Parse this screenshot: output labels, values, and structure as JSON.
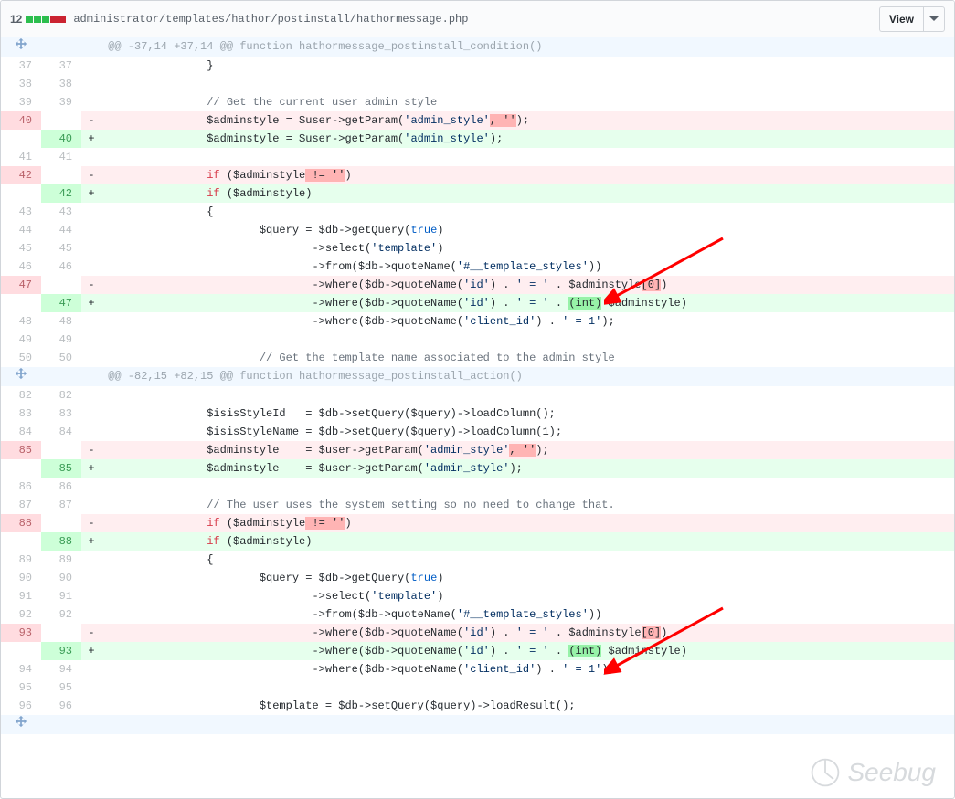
{
  "header": {
    "diff_count": "12",
    "file_path": "administrator/templates/hathor/postinstall/hathormessage.php",
    "view_btn": "View"
  },
  "hunk1": {
    "text": " @@ -37,14 +37,14 @@ function hathormessage_postinstall_condition()"
  },
  "hunk2": {
    "text": " @@ -82,15 +82,15 @@ function hathormessage_postinstall_action()"
  },
  "lines": {
    "l37": "\t\t}",
    "l38": "",
    "l39_c": "\t\t// Get the current user admin style",
    "l40d_a": "\t\t$adminstyle = $user->getParam(",
    "l40d_b": "'admin_style'",
    "l40d_c": ", ''",
    "l40d_d": ");",
    "l40a_a": "\t\t$adminstyle = $user->getParam(",
    "l40a_b": "'admin_style'",
    "l40a_c": ");",
    "l41": "",
    "l42d_a": "\t\t",
    "l42d_if": "if",
    "l42d_b": " ($adminstyle",
    "l42d_c": " != ''",
    "l42d_d": ")",
    "l42a_a": "\t\t",
    "l42a_if": "if",
    "l42a_b": " ($adminstyle)",
    "l43": "\t\t{",
    "l44_a": "\t\t\t$query = $db->getQuery(",
    "l44_true": "true",
    "l44_b": ")",
    "l45_a": "\t\t\t\t->select(",
    "l45_b": "'template'",
    "l45_c": ")",
    "l46_a": "\t\t\t\t->from($db->quoteName(",
    "l46_b": "'#__template_styles'",
    "l46_c": "))",
    "l47d_a": "\t\t\t\t->where($db->quoteName(",
    "l47d_b": "'id'",
    "l47d_c": ") . ",
    "l47d_d": "' = '",
    "l47d_e": " . $adminstyle",
    "l47d_f": "[0]",
    "l47d_g": ")",
    "l47a_a": "\t\t\t\t->where($db->quoteName(",
    "l47a_b": "'id'",
    "l47a_c": ") . ",
    "l47a_d": "' = '",
    "l47a_e": " . ",
    "l47a_f": "(int)",
    "l47a_g": " $adminstyle)",
    "l48_a": "\t\t\t\t->where($db->quoteName(",
    "l48_b": "'client_id'",
    "l48_c": ") . ",
    "l48_d": "' = 1'",
    "l48_e": ");",
    "l49": "",
    "l50_c": "\t\t\t// Get the template name associated to the admin style",
    "l82": "",
    "l83_a": "\t\t$isisStyleId   = $db->setQuery($query)->loadColumn();",
    "l84_a": "\t\t$isisStyleName = $db->setQuery($query)->loadColumn(1);",
    "l85d_a": "\t\t$adminstyle    = $user->getParam(",
    "l85d_b": "'admin_style'",
    "l85d_c": ", ''",
    "l85d_d": ");",
    "l85a_a": "\t\t$adminstyle    = $user->getParam(",
    "l85a_b": "'admin_style'",
    "l85a_c": ");",
    "l86": "",
    "l87_c": "\t\t// The user uses the system setting so no need to change that.",
    "l88d_a": "\t\t",
    "l88d_if": "if",
    "l88d_b": " ($adminstyle",
    "l88d_c": " != ''",
    "l88d_d": ")",
    "l88a_a": "\t\t",
    "l88a_if": "if",
    "l88a_b": " ($adminstyle)",
    "l89": "\t\t{",
    "l90_a": "\t\t\t$query = $db->getQuery(",
    "l90_true": "true",
    "l90_b": ")",
    "l91_a": "\t\t\t\t->select(",
    "l91_b": "'template'",
    "l91_c": ")",
    "l92_a": "\t\t\t\t->from($db->quoteName(",
    "l92_b": "'#__template_styles'",
    "l92_c": "))",
    "l93d_a": "\t\t\t\t->where($db->quoteName(",
    "l93d_b": "'id'",
    "l93d_c": ") . ",
    "l93d_d": "' = '",
    "l93d_e": " . $adminstyle",
    "l93d_f": "[0]",
    "l93d_g": ")",
    "l93a_a": "\t\t\t\t->where($db->quoteName(",
    "l93a_b": "'id'",
    "l93a_c": ") . ",
    "l93a_d": "' = '",
    "l93a_e": " . ",
    "l93a_f": "(int)",
    "l93a_g": " $adminstyle)",
    "l94_a": "\t\t\t\t->where($db->quoteName(",
    "l94_b": "'client_id'",
    "l94_c": ") . ",
    "l94_d": "' = 1'",
    "l94_e": ");",
    "l95": "",
    "l96_a": "\t\t\t$template = $db->setQuery($query)->loadResult();"
  },
  "nums": {
    "n37": "37",
    "n38": "38",
    "n39": "39",
    "n40": "40",
    "n41": "41",
    "n42": "42",
    "n43": "43",
    "n44": "44",
    "n45": "45",
    "n46": "46",
    "n47": "47",
    "n48": "48",
    "n49": "49",
    "n50": "50",
    "n82": "82",
    "n83": "83",
    "n84": "84",
    "n85": "85",
    "n86": "86",
    "n87": "87",
    "n88": "88",
    "n89": "89",
    "n90": "90",
    "n91": "91",
    "n92": "92",
    "n93": "93",
    "n94": "94",
    "n95": "95",
    "n96": "96"
  },
  "watermark": "Seebug"
}
